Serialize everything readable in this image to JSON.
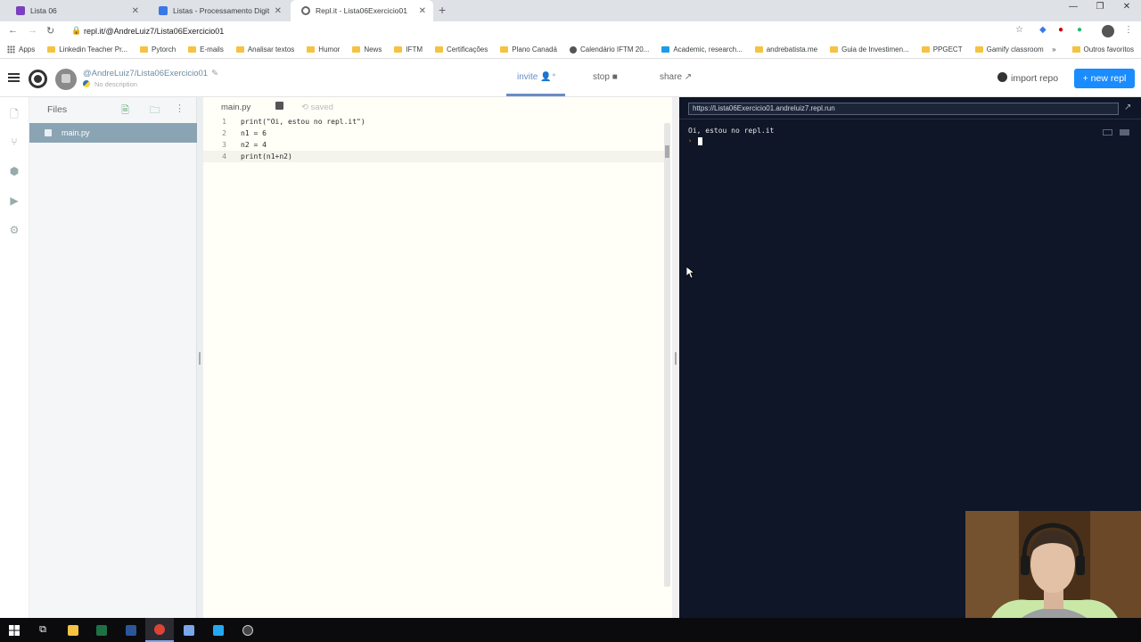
{
  "browser": {
    "tabs": [
      {
        "title": "Lista 06",
        "active": false,
        "color": "#7b3fbf"
      },
      {
        "title": "Listas - Processamento Digital de",
        "active": false,
        "color": "#3b78e7"
      },
      {
        "title": "Repl.it - Lista06Exercicio01",
        "active": true,
        "color": "#666666"
      }
    ],
    "new_tab": "+",
    "close_glyph": "✕",
    "url": "repl.it/@AndreLuiz7/Lista06Exercicio01",
    "bookmarks": [
      "Apps",
      "Linkedin Teacher Pr...",
      "Pytorch",
      "E-mails",
      "Analisar textos",
      "Humor",
      "News",
      "IFTM",
      "Certificações",
      "Plano Canadá",
      "Calendário IFTM 20...",
      "Academic, research...",
      "andrebatista.me",
      "Guia de Investimen...",
      "PPGECT",
      "Gamify classroom"
    ],
    "bookmarks_more": "»",
    "other_bookmarks": "Outros favoritos"
  },
  "repl": {
    "owner_path": "@AndreLuiz7/Lista06Exercicio01",
    "description": "No description",
    "invite_label": "invite",
    "stop_label": "stop",
    "share_label": "share",
    "import_label": "import repo",
    "new_repl_label": "+ new repl",
    "files_title": "Files",
    "files": [
      "main.py"
    ],
    "editor_tab": "main.py",
    "saved_label": "saved",
    "code_lines": [
      {
        "n": "1",
        "text": "print(\"Oi, estou no repl.it\")"
      },
      {
        "n": "2",
        "text": "n1 = 6"
      },
      {
        "n": "3",
        "text": "n2 = 4"
      },
      {
        "n": "4",
        "text": "print(n1+n2)"
      }
    ],
    "console_url": "https://Lista06Exercicio01.andreluiz7.repl.run",
    "console_output": "Oi, estou no repl.it",
    "console_prompt": "›"
  },
  "colors": {
    "accent": "#1a8cff",
    "file_selected": "#8aa4b3",
    "console_bg": "#0e1628",
    "editor_bg": "#fffff8"
  },
  "taskbar": {
    "items": [
      "windows-start",
      "task-view",
      "file-explorer",
      "excel",
      "word",
      "chrome",
      "image-viewer",
      "vscode",
      "obs"
    ]
  }
}
